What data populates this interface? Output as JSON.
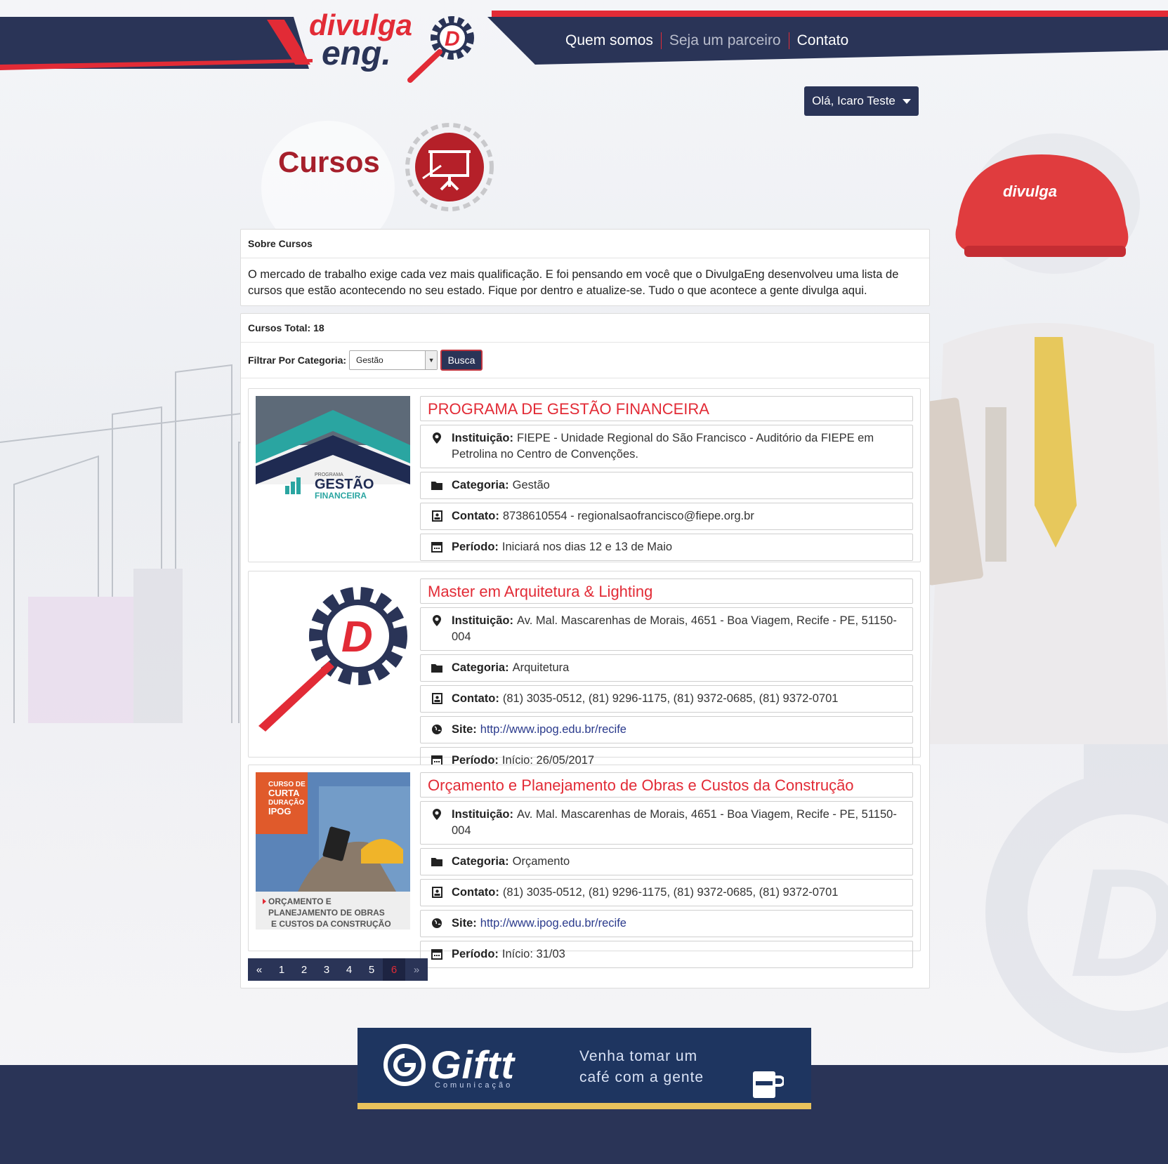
{
  "nav": {
    "quem_somos": "Quem somos",
    "parceiro": "Seja um parceiro",
    "contato": "Contato"
  },
  "user_menu": "Olá, Icaro Teste",
  "page_title": "Cursos",
  "about": {
    "heading": "Sobre Cursos",
    "text": "O mercado de trabalho exige cada vez mais qualificação. E foi pensando em você que o DivulgaEng desenvolveu uma lista de cursos que estão acontecendo no seu estado. Fique por dentro e atualize-se. Tudo o que acontece a gente divulga aqui."
  },
  "list": {
    "total_label": "Cursos Total: 18",
    "filter_label": "Filtrar Por Categoria:",
    "filter_value": "Gestão",
    "search_button": "Busca"
  },
  "labels": {
    "instituicao": "Instituição:",
    "categoria": "Categoria:",
    "contato": "Contato:",
    "site": "Site:",
    "periodo": "Período:"
  },
  "courses": [
    {
      "title": "PROGRAMA DE GESTÃO FINANCEIRA",
      "instituicao": "FIEPE - Unidade Regional do São Francisco - Auditório da FIEPE em Petrolina no Centro de Convenções.",
      "categoria": "Gestão",
      "contato": "8738610554 - regionalsaofrancisco@fiepe.org.br",
      "periodo": "Iniciará nos dias 12 e 13 de Maio",
      "thumb_small": "PROGRAMA",
      "thumb_big": "GESTÃO",
      "thumb_sub": "FINANCEIRA"
    },
    {
      "title": "Master em Arquitetura & Lighting",
      "instituicao": "Av. Mal. Mascarenhas de Morais, 4651 - Boa Viagem, Recife - PE, 51150-004",
      "categoria": "Arquitetura",
      "contato": "(81) 3035-0512, (81) 9296-1175, (81) 9372-0685, (81) 9372-0701",
      "site": "http://www.ipog.edu.br/recife",
      "periodo": "Início: 26/05/2017"
    },
    {
      "title": "Orçamento e Planejamento de Obras e Custos da Construção",
      "instituicao": "Av. Mal. Mascarenhas de Morais, 4651 - Boa Viagem, Recife - PE, 51150-004",
      "categoria": "Orçamento",
      "contato": "(81) 3035-0512, (81) 9296-1175, (81) 9372-0685, (81) 9372-0701",
      "site": "http://www.ipog.edu.br/recife",
      "periodo": "Início: 31/03",
      "thumb_tag": [
        "CURSO DE",
        "CURTA",
        "DURAÇÃO",
        "IPOG"
      ],
      "thumb_caption": [
        "ORÇAMENTO E",
        "PLANEJAMENTO DE OBRAS",
        "E CUSTOS DA CONSTRUÇÃO"
      ]
    }
  ],
  "pagination": {
    "prev": "«",
    "pages": [
      "1",
      "2",
      "3",
      "4",
      "5",
      "6"
    ],
    "active": "6",
    "next": "»"
  },
  "banner": {
    "brand": "Giftt",
    "sub": "Comunicação",
    "slogan_line1": "Venha tomar um",
    "slogan_line2": "café com a gente"
  },
  "colors": {
    "navy": "#2a3457",
    "red": "#e22b36",
    "title_red": "#a61f2b"
  }
}
